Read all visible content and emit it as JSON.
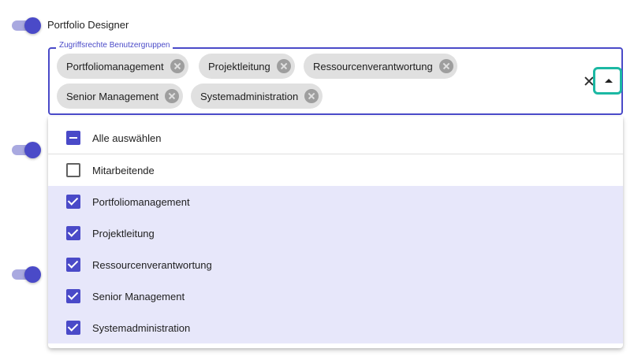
{
  "toggle_label": "Portfolio Designer",
  "field": {
    "legend": "Zugriffsrechte Benutzergruppen",
    "chips": [
      "Portfoliomanagement",
      "Projektleitung",
      "Ressourcenverantwortung",
      "Senior Management",
      "Systemadministration"
    ]
  },
  "listbox": {
    "options": [
      {
        "label": "Alle auswählen",
        "state": "indeterminate"
      },
      {
        "label": "Mitarbeitende",
        "state": "unchecked"
      },
      {
        "label": "Portfoliomanagement",
        "state": "checked"
      },
      {
        "label": "Projektleitung",
        "state": "checked"
      },
      {
        "label": "Ressourcenverantwortung",
        "state": "checked"
      },
      {
        "label": "Senior Management",
        "state": "checked"
      },
      {
        "label": "Systemadministration",
        "state": "checked"
      }
    ]
  },
  "colors": {
    "accent": "#4a4ac8",
    "focus_ring": "#1cb8a3",
    "selected_row": "#e7e7fa"
  }
}
